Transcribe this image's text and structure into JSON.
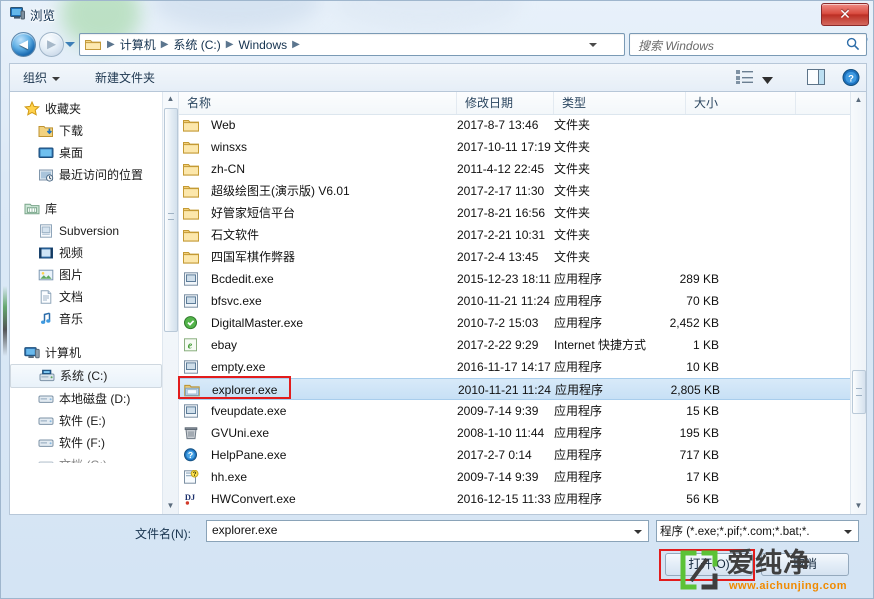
{
  "window": {
    "title": "浏览",
    "close_label": "✕",
    "icon": "computer-icon"
  },
  "nav": {
    "back_glyph": "◄",
    "forward_glyph": "►",
    "breadcrumbs": [
      "计算机",
      "系统 (C:)",
      "Windows"
    ],
    "separator": "▶",
    "refresh_glyph": "↻"
  },
  "search": {
    "placeholder": "搜索 Windows"
  },
  "toolbar": {
    "organize_label": "组织",
    "new_folder_label": "新建文件夹"
  },
  "sidebar": {
    "items": [
      {
        "label": "收藏夹",
        "icon": "star-icon",
        "level": 0,
        "selected": false
      },
      {
        "label": "下载",
        "icon": "downloads-icon",
        "level": 1,
        "selected": false
      },
      {
        "label": "桌面",
        "icon": "desktop-icon",
        "level": 1,
        "selected": false
      },
      {
        "label": "最近访问的位置",
        "icon": "recent-places-icon",
        "level": 1,
        "selected": false
      },
      {
        "label": "库",
        "icon": "library-icon",
        "level": 0,
        "selected": false
      },
      {
        "label": "Subversion",
        "icon": "folder-doc-icon",
        "level": 1,
        "selected": false
      },
      {
        "label": "视频",
        "icon": "video-icon",
        "level": 1,
        "selected": false
      },
      {
        "label": "图片",
        "icon": "pictures-icon",
        "level": 1,
        "selected": false
      },
      {
        "label": "文档",
        "icon": "documents-icon",
        "level": 1,
        "selected": false
      },
      {
        "label": "音乐",
        "icon": "music-icon",
        "level": 1,
        "selected": false
      },
      {
        "label": "计算机",
        "icon": "computer-icon",
        "level": 0,
        "selected": false
      },
      {
        "label": "系统 (C:)",
        "icon": "system-drive-icon",
        "level": 1,
        "selected": true
      },
      {
        "label": "本地磁盘 (D:)",
        "icon": "drive-icon",
        "level": 1,
        "selected": false
      },
      {
        "label": "软件 (E:)",
        "icon": "drive-icon",
        "level": 1,
        "selected": false
      },
      {
        "label": "软件 (F:)",
        "icon": "drive-icon",
        "level": 1,
        "selected": false
      },
      {
        "label": "文档 (G:)",
        "icon": "drive-icon",
        "level": 1,
        "selected": false
      }
    ]
  },
  "filelist": {
    "columns": [
      "名称",
      "修改日期",
      "类型",
      "大小"
    ],
    "rows": [
      {
        "name": "Web",
        "date": "2017-8-7 13:46",
        "type": "文件夹",
        "size": "",
        "icon": "folder-icon",
        "selected": false
      },
      {
        "name": "winsxs",
        "date": "2017-10-11 17:19",
        "type": "文件夹",
        "size": "",
        "icon": "folder-icon",
        "selected": false
      },
      {
        "name": "zh-CN",
        "date": "2011-4-12 22:45",
        "type": "文件夹",
        "size": "",
        "icon": "folder-icon",
        "selected": false
      },
      {
        "name": "超级绘图王(演示版) V6.01",
        "date": "2017-2-17 11:30",
        "type": "文件夹",
        "size": "",
        "icon": "folder-icon",
        "selected": false
      },
      {
        "name": "好管家短信平台",
        "date": "2017-8-21 16:56",
        "type": "文件夹",
        "size": "",
        "icon": "folder-icon",
        "selected": false
      },
      {
        "name": "石文软件",
        "date": "2017-2-21 10:31",
        "type": "文件夹",
        "size": "",
        "icon": "folder-icon",
        "selected": false
      },
      {
        "name": "四国军棋作弊器",
        "date": "2017-2-4 13:45",
        "type": "文件夹",
        "size": "",
        "icon": "folder-icon",
        "selected": false
      },
      {
        "name": "Bcdedit.exe",
        "date": "2015-12-23 18:11",
        "type": "应用程序",
        "size": "289 KB",
        "icon": "exe-generic-icon",
        "selected": false
      },
      {
        "name": "bfsvc.exe",
        "date": "2010-11-21 11:24",
        "type": "应用程序",
        "size": "70 KB",
        "icon": "exe-generic-icon",
        "selected": false
      },
      {
        "name": "DigitalMaster.exe",
        "date": "2010-7-2 15:03",
        "type": "应用程序",
        "size": "2,452 KB",
        "icon": "exe-green-icon",
        "selected": false
      },
      {
        "name": "ebay",
        "date": "2017-2-22 9:29",
        "type": "Internet 快捷方式",
        "size": "1 KB",
        "icon": "ie-shortcut-icon",
        "selected": false
      },
      {
        "name": "empty.exe",
        "date": "2016-11-17 14:17",
        "type": "应用程序",
        "size": "10 KB",
        "icon": "exe-generic-icon",
        "selected": false
      },
      {
        "name": "explorer.exe",
        "date": "2010-11-21 11:24",
        "type": "应用程序",
        "size": "2,805 KB",
        "icon": "explorer-icon",
        "selected": true
      },
      {
        "name": "fveupdate.exe",
        "date": "2009-7-14 9:39",
        "type": "应用程序",
        "size": "15 KB",
        "icon": "exe-generic-icon",
        "selected": false
      },
      {
        "name": "GVUni.exe",
        "date": "2008-1-10 11:44",
        "type": "应用程序",
        "size": "195 KB",
        "icon": "trash-icon",
        "selected": false
      },
      {
        "name": "HelpPane.exe",
        "date": "2017-2-7 0:14",
        "type": "应用程序",
        "size": "717 KB",
        "icon": "help-blue-icon",
        "selected": false
      },
      {
        "name": "hh.exe",
        "date": "2009-7-14 9:39",
        "type": "应用程序",
        "size": "17 KB",
        "icon": "hh-icon",
        "selected": false
      },
      {
        "name": "HWConvert.exe",
        "date": "2016-12-15 11:33",
        "type": "应用程序",
        "size": "56 KB",
        "icon": "dj-icon",
        "selected": false
      }
    ]
  },
  "footer": {
    "filename_label": "文件名(N):",
    "filename_value": "explorer.exe",
    "filetype_value": "程序 (*.exe;*.pif;*.com;*.bat;*.",
    "open_label": "打开(O)",
    "cancel_label": "取消"
  },
  "watermark": {
    "text": "爱纯净",
    "url": "www.aichunjing.com",
    "color": "#3f3f3f",
    "accent": "#5bc236",
    "url_color": "#f08a00"
  },
  "annotations": {
    "highlight_color": "#e21c1c",
    "selection_color": "#c7e0f5"
  }
}
